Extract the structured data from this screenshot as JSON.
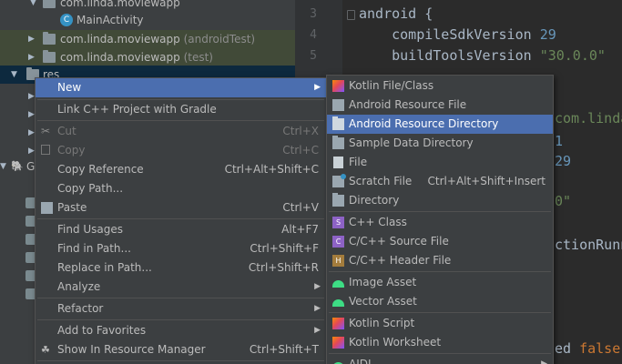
{
  "tree": {
    "rows": [
      {
        "label": "com.linda.moviewapp",
        "suffix": ""
      },
      {
        "label": "MainActivity",
        "suffix": ""
      },
      {
        "label": "com.linda.moviewapp",
        "suffix": " (androidTest)"
      },
      {
        "label": "com.linda.moviewapp",
        "suffix": " (test)"
      },
      {
        "label": "res",
        "suffix": ""
      },
      {
        "label": "G",
        "suffix": ""
      }
    ]
  },
  "editor": {
    "line_numbers": [
      "3",
      "4",
      "5"
    ],
    "lines": [
      {
        "a": "android {",
        "b": "",
        "c": ""
      },
      {
        "a": "    compileSdkVersion ",
        "b": "29",
        "c": ""
      },
      {
        "a": "    buildToolsVersion ",
        "b": "\"30.0.0\"",
        "c": ""
      }
    ],
    "fragments": {
      "pkg": "com.linda",
      "one": "1",
      "n29": "29",
      "quote": "0\"",
      "runner": "ctionRunner",
      "ed": "ed ",
      "false": "false"
    }
  },
  "context_menu": {
    "items": [
      {
        "label": "New",
        "shortcut": ""
      },
      {
        "label": "Link C++ Project with Gradle",
        "shortcut": ""
      },
      {
        "label": "Cut",
        "shortcut": "Ctrl+X"
      },
      {
        "label": "Copy",
        "shortcut": "Ctrl+C"
      },
      {
        "label": "Copy Reference",
        "shortcut": "Ctrl+Alt+Shift+C"
      },
      {
        "label": "Copy Path...",
        "shortcut": ""
      },
      {
        "label": "Paste",
        "shortcut": "Ctrl+V"
      },
      {
        "label": "Find Usages",
        "shortcut": "Alt+F7"
      },
      {
        "label": "Find in Path...",
        "shortcut": "Ctrl+Shift+F"
      },
      {
        "label": "Replace in Path...",
        "shortcut": "Ctrl+Shift+R"
      },
      {
        "label": "Analyze",
        "shortcut": ""
      },
      {
        "label": "Refactor",
        "shortcut": ""
      },
      {
        "label": "Add to Favorites",
        "shortcut": ""
      },
      {
        "label": "Show In Resource Manager",
        "shortcut": "Ctrl+Shift+T"
      }
    ]
  },
  "submenu": {
    "items": [
      {
        "label": "Kotlin File/Class",
        "shortcut": ""
      },
      {
        "label": "Android Resource File",
        "shortcut": ""
      },
      {
        "label": "Android Resource Directory",
        "shortcut": ""
      },
      {
        "label": "Sample Data Directory",
        "shortcut": ""
      },
      {
        "label": "File",
        "shortcut": ""
      },
      {
        "label": "Scratch File",
        "shortcut": "Ctrl+Alt+Shift+Insert"
      },
      {
        "label": "Directory",
        "shortcut": ""
      },
      {
        "label": "C++ Class",
        "shortcut": ""
      },
      {
        "label": "C/C++ Source File",
        "shortcut": ""
      },
      {
        "label": "C/C++ Header File",
        "shortcut": ""
      },
      {
        "label": "Image Asset",
        "shortcut": ""
      },
      {
        "label": "Vector Asset",
        "shortcut": ""
      },
      {
        "label": "Kotlin Script",
        "shortcut": ""
      },
      {
        "label": "Kotlin Worksheet",
        "shortcut": ""
      },
      {
        "label": "AIDL",
        "shortcut": ""
      }
    ]
  },
  "colors": {
    "selection": "#4b6eaf",
    "tree_background": "#3c3f41",
    "editor_background": "#2b2b2b",
    "keyword": "#cc7832",
    "number": "#6897bb",
    "string": "#6a8759"
  }
}
